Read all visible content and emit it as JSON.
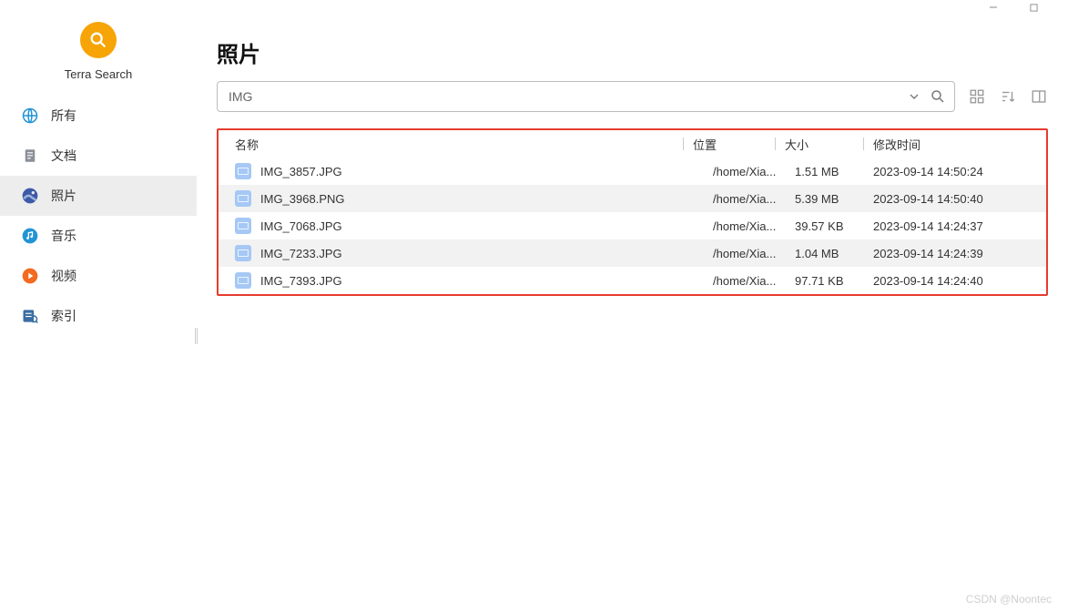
{
  "app_name": "Terra Search",
  "page_title": "照片",
  "search_value": "IMG",
  "sidebar": {
    "items": [
      {
        "label": "所有",
        "icon": "globe-icon",
        "active": false
      },
      {
        "label": "文档",
        "icon": "document-icon",
        "active": false
      },
      {
        "label": "照片",
        "icon": "photo-icon",
        "active": true
      },
      {
        "label": "音乐",
        "icon": "music-icon",
        "active": false
      },
      {
        "label": "视频",
        "icon": "video-icon",
        "active": false
      },
      {
        "label": "索引",
        "icon": "index-icon",
        "active": false
      }
    ]
  },
  "table": {
    "headers": {
      "name": "名称",
      "location": "位置",
      "size": "大小",
      "modified": "修改时间"
    },
    "rows": [
      {
        "name": "IMG_3857.JPG",
        "location": "/home/Xia...",
        "size": "1.51 MB",
        "modified": "2023-09-14 14:50:24"
      },
      {
        "name": "IMG_3968.PNG",
        "location": "/home/Xia...",
        "size": "5.39 MB",
        "modified": "2023-09-14 14:50:40"
      },
      {
        "name": "IMG_7068.JPG",
        "location": "/home/Xia...",
        "size": "39.57 KB",
        "modified": "2023-09-14 14:24:37"
      },
      {
        "name": "IMG_7233.JPG",
        "location": "/home/Xia...",
        "size": "1.04 MB",
        "modified": "2023-09-14 14:24:39"
      },
      {
        "name": "IMG_7393.JPG",
        "location": "/home/Xia...",
        "size": "97.71 KB",
        "modified": "2023-09-14 14:24:40"
      }
    ]
  },
  "watermark": "CSDN @Noontec"
}
